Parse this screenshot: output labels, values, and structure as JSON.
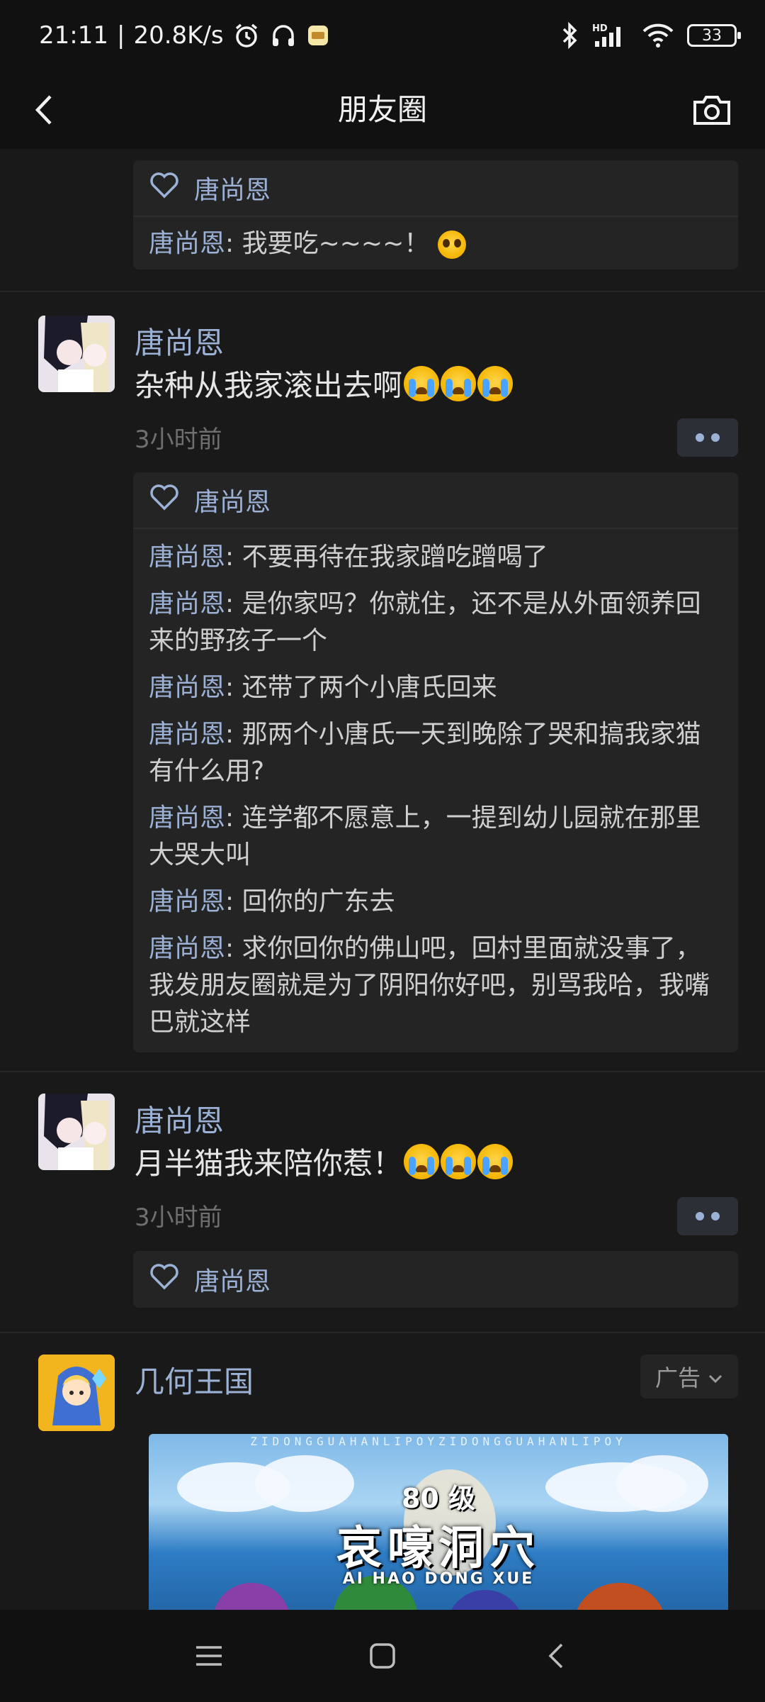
{
  "status_bar": {
    "time": "21:11",
    "separator": "|",
    "net_speed": "20.8K/s",
    "icons": [
      "alarm-icon",
      "headphones-icon",
      "app-notification-icon",
      "bluetooth-icon",
      "hd-signal-icon",
      "wifi-icon"
    ],
    "signal_label": "HD",
    "battery": "33"
  },
  "nav": {
    "title": "朋友圈",
    "back_icon": "back-chevron-icon",
    "camera_icon": "camera-icon"
  },
  "posts": [
    {
      "likes": [
        "唐尚恩"
      ],
      "comments": [
        {
          "author": "唐尚恩",
          "text": ": 我要吃~~~~！",
          "emoji": "pleading-face"
        }
      ]
    },
    {
      "author": "唐尚恩",
      "text": "杂种从我家滚出去啊",
      "emojis": [
        "loudly-crying-face",
        "loudly-crying-face",
        "loudly-crying-face"
      ],
      "time": "3小时前",
      "likes": [
        "唐尚恩"
      ],
      "comments": [
        {
          "author": "唐尚恩",
          "text": ": 不要再待在我家蹭吃蹭喝了"
        },
        {
          "author": "唐尚恩",
          "text": ": 是你家吗？你就住，还不是从外面领养回来的野孩子一个"
        },
        {
          "author": "唐尚恩",
          "text": ": 还带了两个小唐氏回来"
        },
        {
          "author": "唐尚恩",
          "text": ": 那两个小唐氏一天到晚除了哭和搞我家猫有什么用?"
        },
        {
          "author": "唐尚恩",
          "text": ": 连学都不愿意上，一提到幼儿园就在那里大哭大叫"
        },
        {
          "author": "唐尚恩",
          "text": ": 回你的广东去"
        },
        {
          "author": "唐尚恩",
          "text": ": 求你回你的佛山吧，回村里面就没事了，我发朋友圈就是为了阴阳你好吧，别骂我哈，我嘴巴就这样"
        }
      ]
    },
    {
      "author": "唐尚恩",
      "text": "月半猫我来陪你惹！",
      "emojis": [
        "loudly-crying-face",
        "loudly-crying-face",
        "loudly-crying-face"
      ],
      "time": "3小时前",
      "likes": [
        "唐尚恩"
      ]
    },
    {
      "author": "几何王国",
      "ad_label": "广告",
      "ad_image": {
        "strip_text": "ZIDONGGUAHANLIPOYZIDONGGUAHANLIPOY",
        "level_text": "80 级",
        "title": "哀嚎洞穴",
        "subtitle": "AI HAO DONG XUE"
      }
    }
  ],
  "bottom_nav": {
    "menu_icon": "menu-icon",
    "home_icon": "home-square-icon",
    "back_icon": "back-triangle-icon"
  },
  "colors": {
    "background": "#111111",
    "card": "#242424",
    "name_blue": "#9bb2d6",
    "timestamp": "#6f6f6f"
  }
}
